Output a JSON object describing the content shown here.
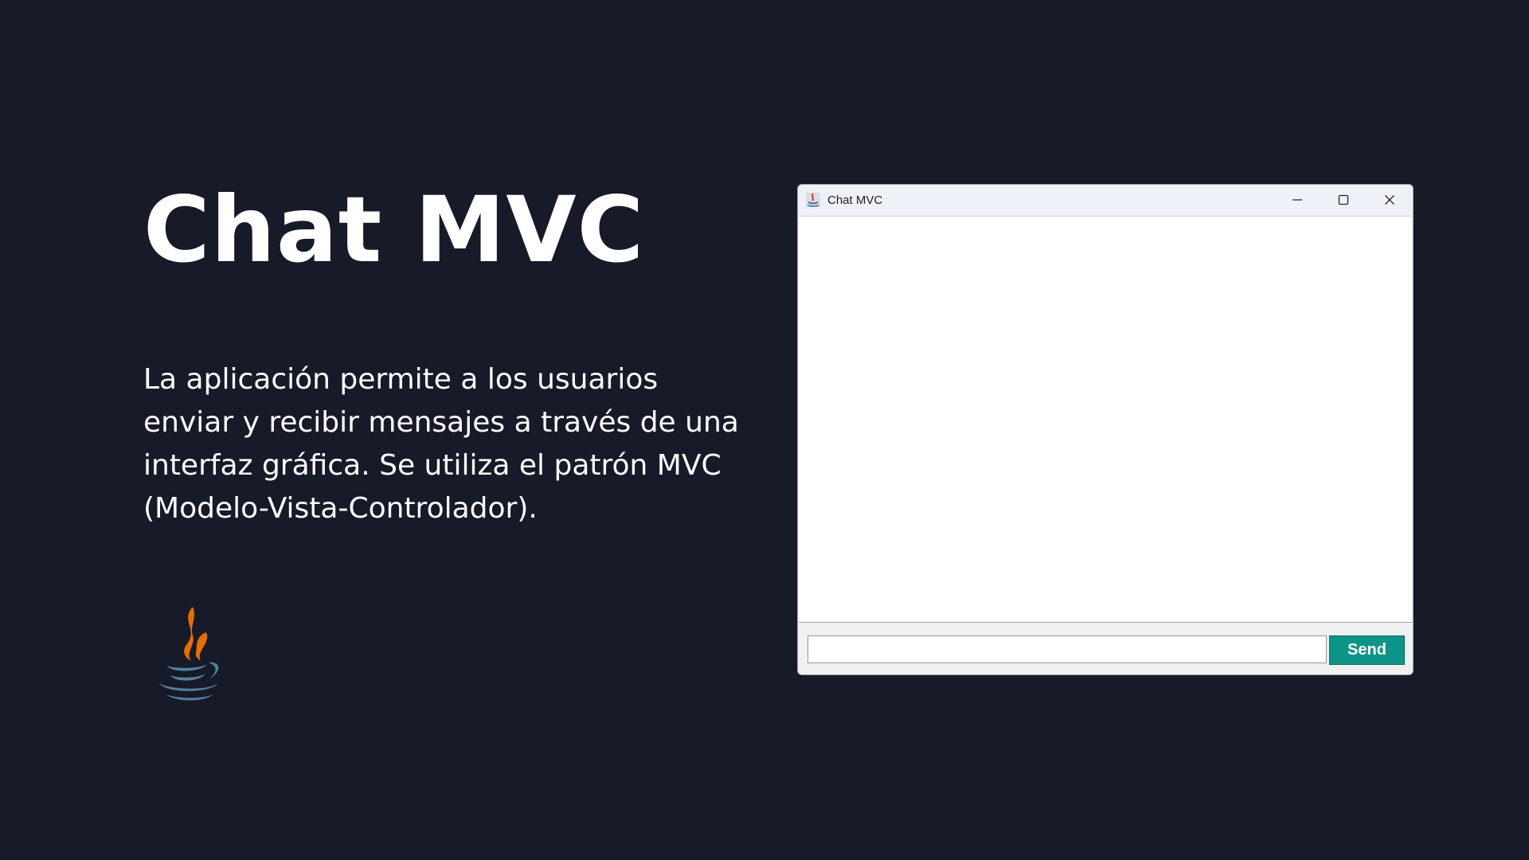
{
  "slide": {
    "title": "Chat MVC",
    "description": "La aplicación permite a los usuarios enviar y recibir mensajes a través de una interfaz gráfica. Se utiliza el patrón MVC (Modelo-Vista-Controlador).",
    "logo_icon": "java-coffee-cup-icon"
  },
  "window": {
    "title": "Chat MVC",
    "app_icon": "java-app-icon",
    "controls": [
      "minimize-icon",
      "maximize-icon",
      "close-icon"
    ],
    "chat_messages": [],
    "input": {
      "value": "",
      "placeholder": ""
    },
    "send_label": "Send"
  },
  "colors": {
    "background": "#171a28",
    "title_text": "#ffffff",
    "send_button": "#0d9488",
    "java_orange": "#e76f00",
    "java_blue": "#5382a1"
  }
}
